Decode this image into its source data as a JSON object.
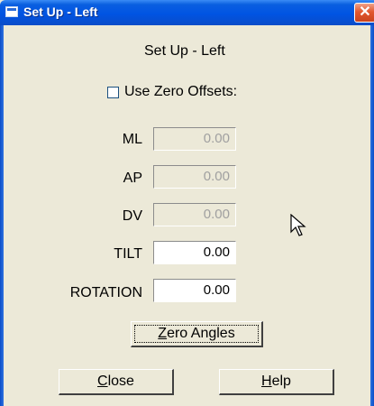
{
  "window": {
    "title": "Set Up - Left",
    "close_glyph": "✕"
  },
  "dialog": {
    "heading": "Set Up - Left",
    "use_zero_offsets": {
      "label": "Use Zero Offsets:",
      "checked": false
    }
  },
  "fields": [
    {
      "label": "ML",
      "value": "0.00",
      "enabled": false
    },
    {
      "label": "AP",
      "value": "0.00",
      "enabled": false
    },
    {
      "label": "DV",
      "value": "0.00",
      "enabled": false
    },
    {
      "label": "TILT",
      "value": "0.00",
      "enabled": true
    },
    {
      "label": "ROTATION",
      "value": "0.00",
      "enabled": true
    }
  ],
  "buttons": {
    "zero_angles": {
      "mnemonic": "Z",
      "rest": "ero Angles"
    },
    "close": {
      "mnemonic": "C",
      "rest": "lose"
    },
    "help": {
      "mnemonic": "H",
      "rest": "elp"
    }
  },
  "icons": {
    "window_icon": "app-window-icon",
    "cursor": "mouse-pointer-icon"
  }
}
